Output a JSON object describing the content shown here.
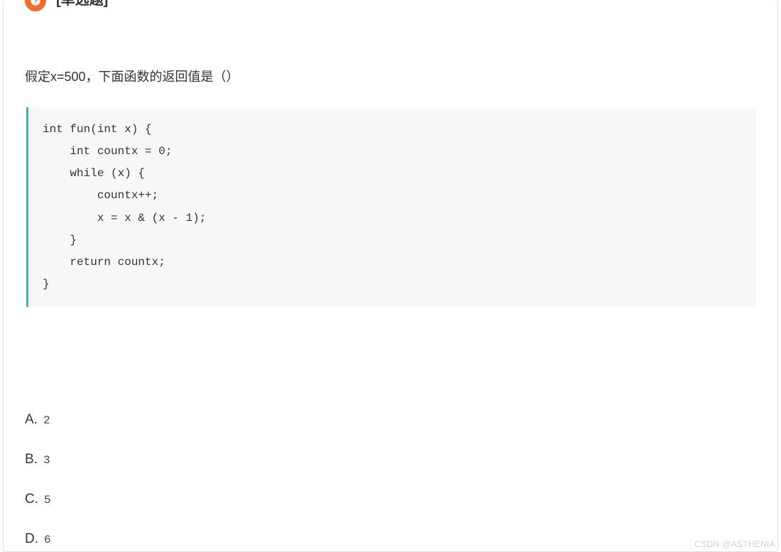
{
  "header": {
    "question_type": "[单选题]"
  },
  "question": {
    "text": "假定x=500，下面函数的返回值是（）",
    "code": "int fun(int x) {\n    int countx = 0;\n    while (x) {\n        countx++;\n        x = x & (x - 1);\n    }\n    return countx;\n}"
  },
  "options": [
    {
      "letter": "A.",
      "value": "2"
    },
    {
      "letter": "B.",
      "value": "3"
    },
    {
      "letter": "C.",
      "value": "5"
    },
    {
      "letter": "D.",
      "value": "6"
    }
  ],
  "watermark": "CSDN @ASTHENIA"
}
